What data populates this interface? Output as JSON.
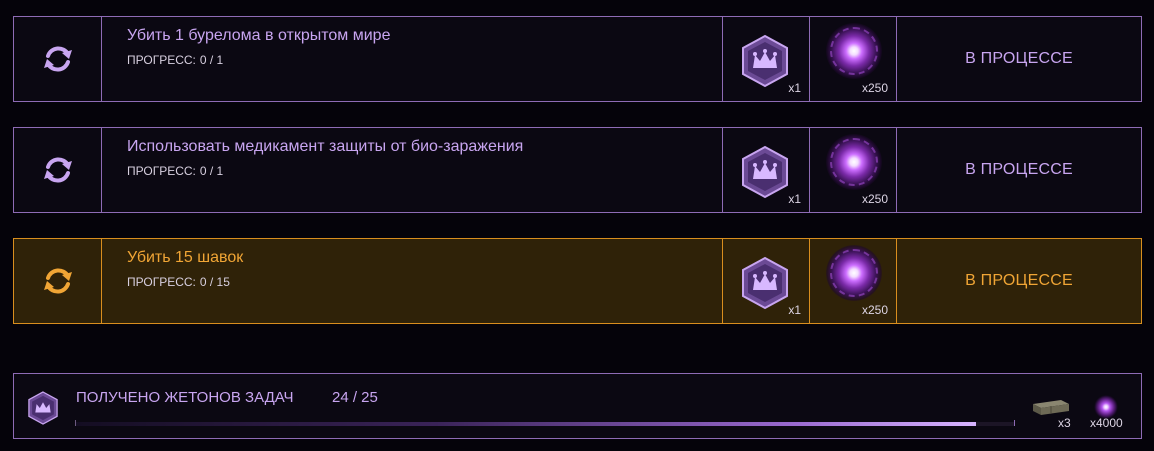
{
  "tasks": [
    {
      "title": "Убить 1 бурелома в открытом мире",
      "progress_label": "ПРОГРЕСС:",
      "progress_value": "0 / 1",
      "badge_qty": "x1",
      "orb_qty": "x250",
      "status": "В ПРОЦЕССЕ",
      "highlighted": false
    },
    {
      "title": "Использовать медикамент защиты от био-заражения",
      "progress_label": "ПРОГРЕСС:",
      "progress_value": "0 / 1",
      "badge_qty": "x1",
      "orb_qty": "x250",
      "status": "В ПРОЦЕССЕ",
      "highlighted": false
    },
    {
      "title": "Убить 15 шавок",
      "progress_label": "ПРОГРЕСС:",
      "progress_value": "0 / 15",
      "badge_qty": "x1",
      "orb_qty": "x250",
      "status": "В ПРОЦЕССЕ",
      "highlighted": true
    }
  ],
  "footer": {
    "label": "ПОЛУЧЕНО ЖЕТОНОВ ЗАДАЧ",
    "count": "24 / 25",
    "progress_fraction": 0.96,
    "crate_qty": "x3",
    "orb_qty": "x4000"
  },
  "colors": {
    "accent_purple": "#c8a5f0",
    "accent_orange": "#f0a535",
    "border_purple": "#8e6bb5",
    "border_orange": "#d98e1e"
  },
  "icons": {
    "refresh": "refresh-icon",
    "crown_badge": "crown-badge-icon",
    "orb": "purple-orb-icon",
    "crate": "ammo-crate-icon"
  }
}
